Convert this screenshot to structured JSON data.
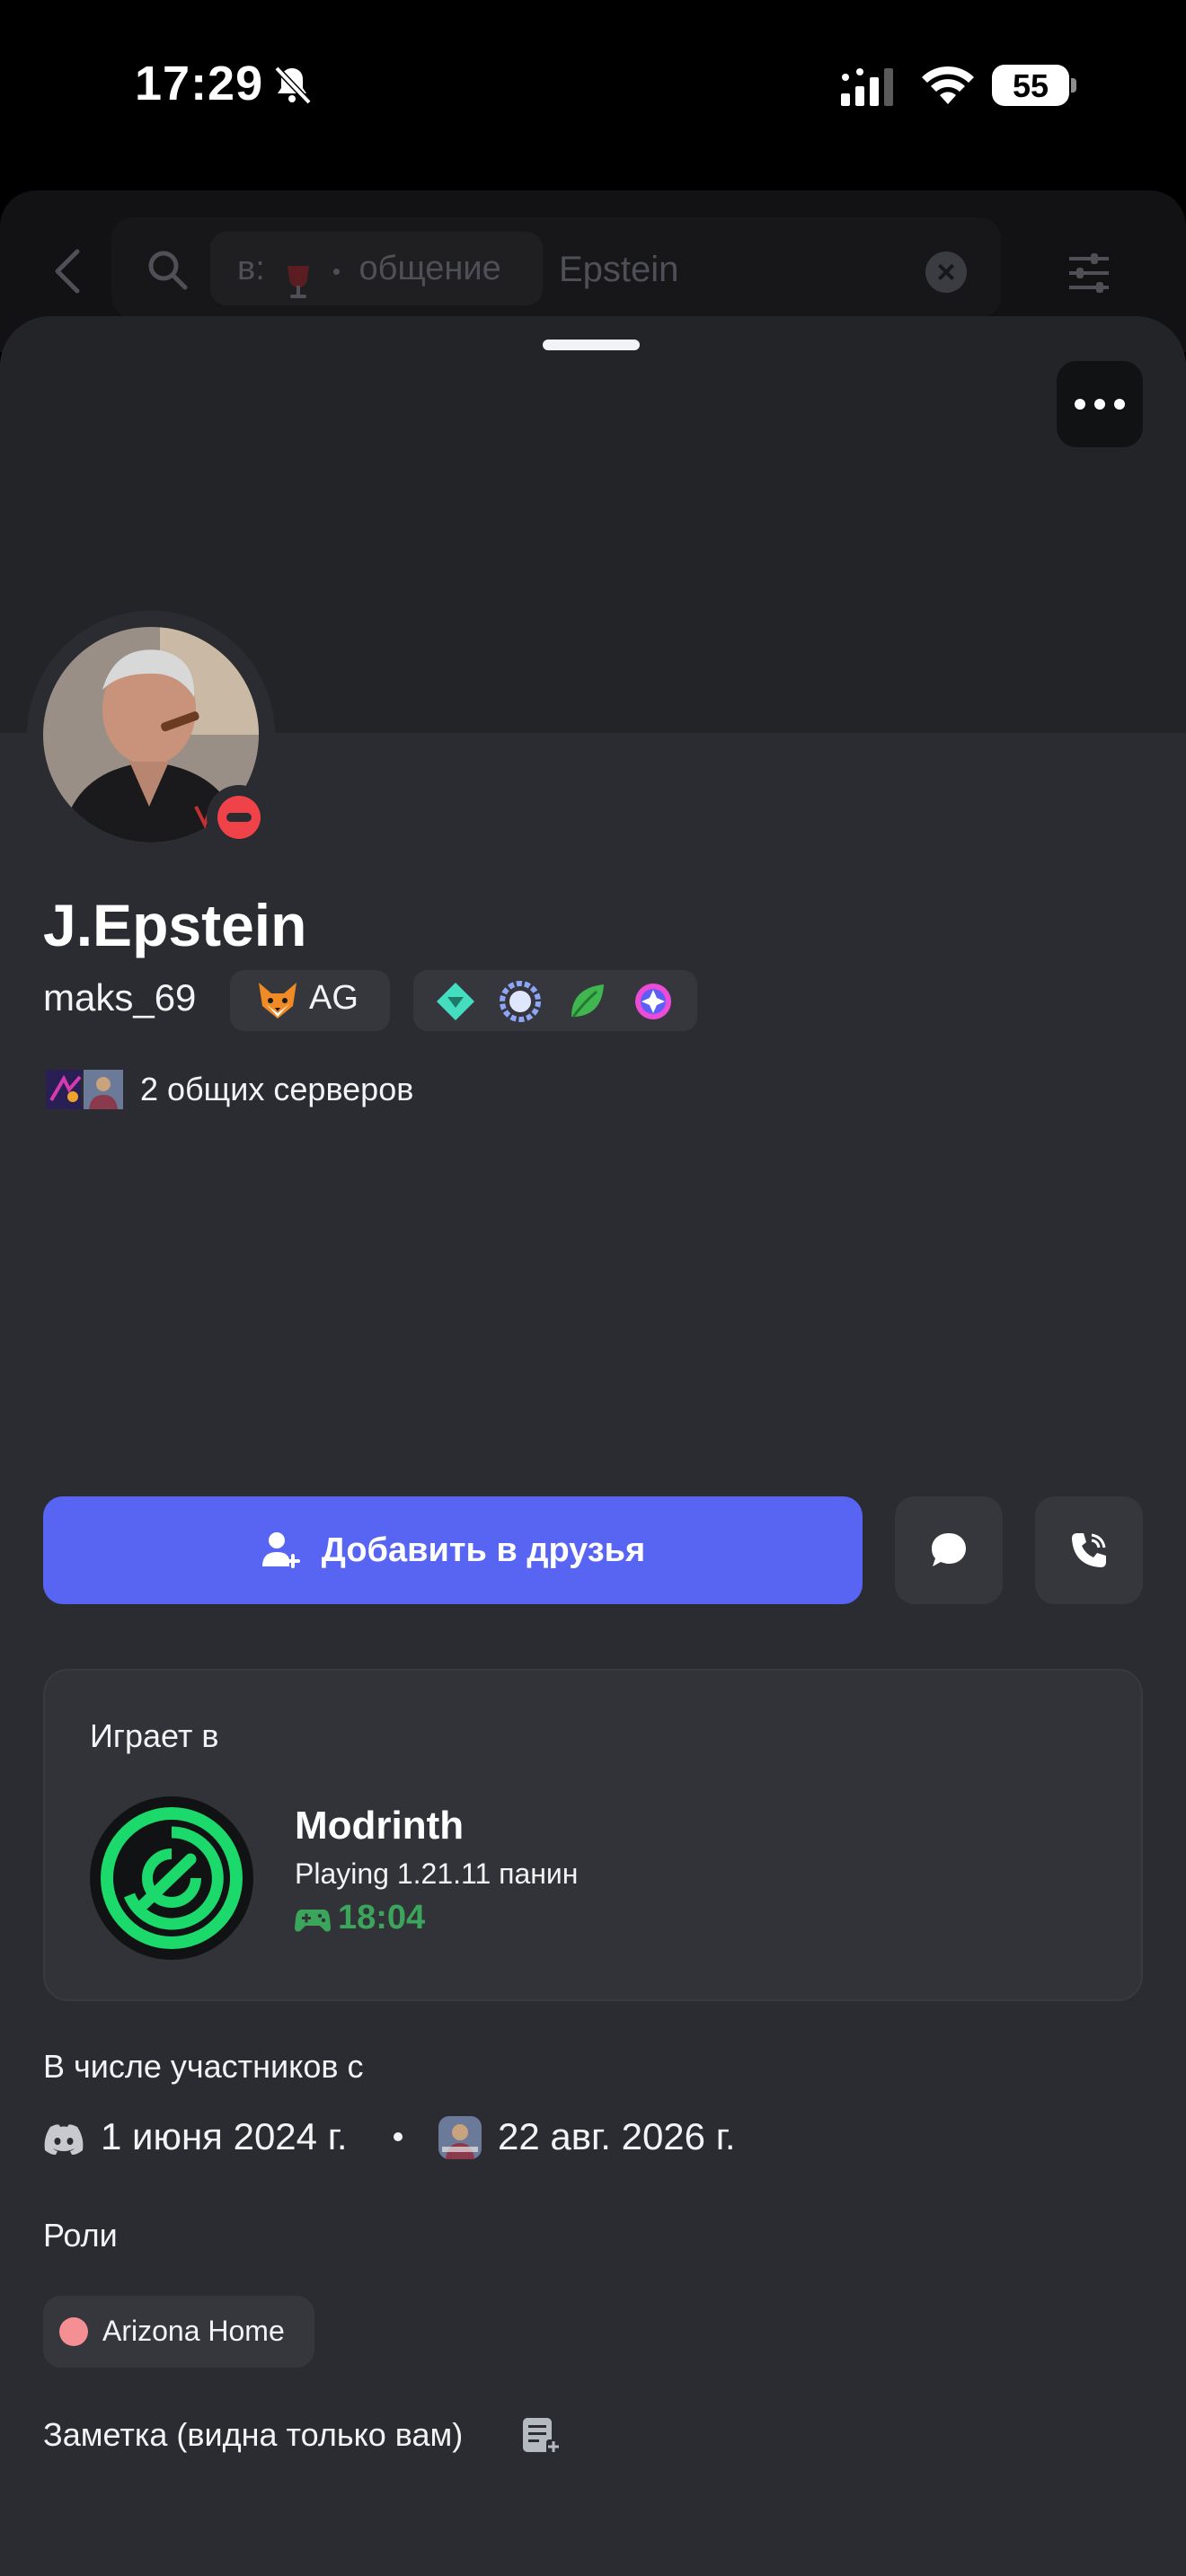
{
  "status_bar": {
    "time": "17:29",
    "battery": "55"
  },
  "search": {
    "chip_prefix": "в:",
    "chip_channel": "общение",
    "query": "Epstein",
    "clear_symbol": "×"
  },
  "profile": {
    "display_name": "J.Epstein",
    "username": "maks_69",
    "tag": "AG",
    "badges": [
      "hypesquad-balance-icon",
      "quest-badge-icon",
      "leaf-badge-icon",
      "nitro-badge-icon"
    ],
    "status": "dnd"
  },
  "mutual": {
    "text": "2 общих серверов"
  },
  "actions": {
    "add_friend_label": "Добавить в друзья"
  },
  "activity": {
    "header": "Играет в",
    "name": "Modrinth",
    "state": "Playing 1.21.11 панин",
    "elapsed": "18:04"
  },
  "member_since": {
    "title": "В числе участников с",
    "discord_date": "1 июня 2024 г.",
    "server_date": "22 авг. 2026 г."
  },
  "roles": {
    "title": "Роли",
    "items": [
      {
        "label": "Arizona Home",
        "color": "#f48f94"
      }
    ]
  },
  "note": {
    "title": "Заметка (видна только вам)"
  },
  "colors": {
    "accent": "#5865f2",
    "dnd": "#ef4249",
    "timer_green": "#3ba55c",
    "modrinth_green": "#1bd96a"
  }
}
